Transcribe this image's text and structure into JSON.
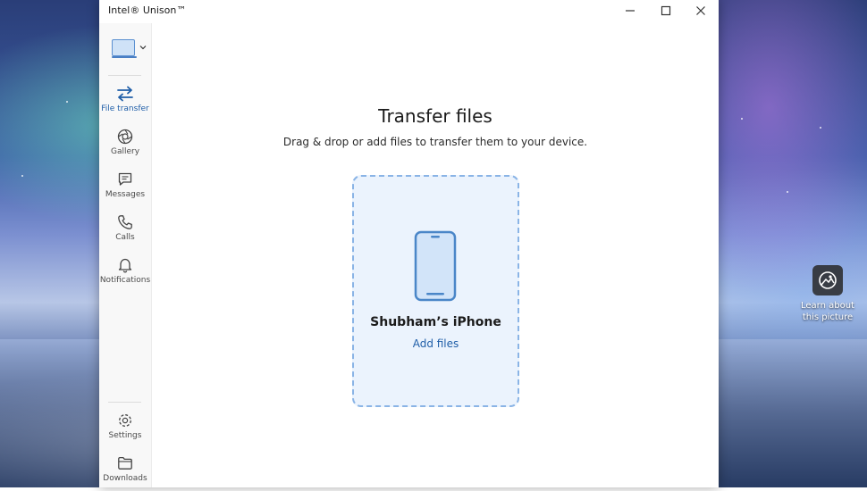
{
  "window": {
    "title": "Intel® Unison™"
  },
  "sidebar": {
    "items": [
      {
        "label": "File transfer",
        "icon": "transfer-arrows-icon",
        "active": true
      },
      {
        "label": "Gallery",
        "icon": "aperture-icon",
        "active": false
      },
      {
        "label": "Messages",
        "icon": "chat-bubble-icon",
        "active": false
      },
      {
        "label": "Calls",
        "icon": "phone-icon",
        "active": false
      },
      {
        "label": "Notifications",
        "icon": "bell-icon",
        "active": false
      }
    ],
    "bottom_items": [
      {
        "label": "Settings",
        "icon": "gear-icon"
      },
      {
        "label": "Downloads",
        "icon": "folder-icon"
      }
    ]
  },
  "main": {
    "heading": "Transfer files",
    "subtitle": "Drag & drop or add files to transfer them to your device.",
    "device_name": "Shubham’s iPhone",
    "add_files_label": "Add files"
  },
  "desktop": {
    "icon_label": "Learn about this picture"
  },
  "colors": {
    "accent": "#1f5ea8",
    "dropzone_bg": "#ebf3fd",
    "dropzone_border": "#8ab4e6"
  }
}
